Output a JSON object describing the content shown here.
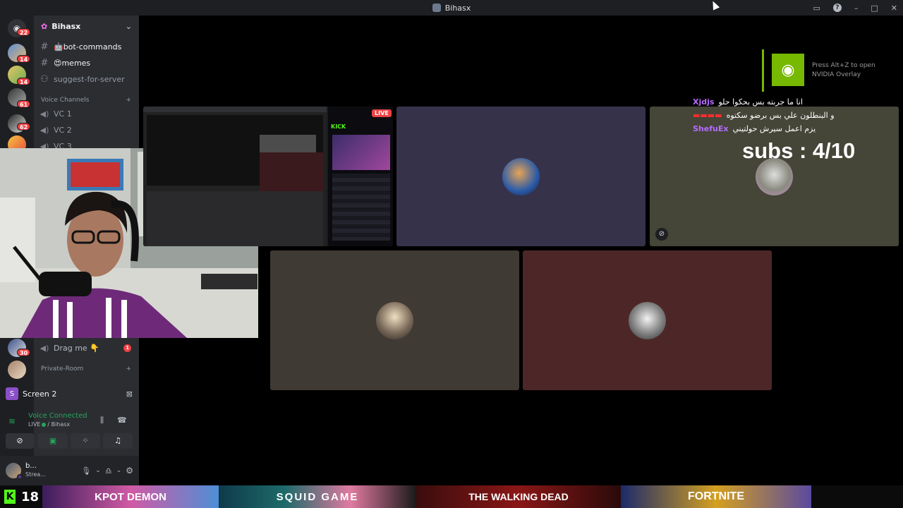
{
  "window": {
    "title": "Bihasx"
  },
  "guilds": {
    "badges": [
      "22",
      "14",
      "14",
      "61",
      "62",
      "30"
    ]
  },
  "server": {
    "name": "Bihasx",
    "channels": [
      {
        "label": "🤖bot-commands"
      },
      {
        "label": "😍memes"
      },
      {
        "label": "suggest-for-server"
      }
    ],
    "voice_category": "Voice Channels",
    "voice_channels": [
      "VC 1",
      "VC 2",
      "VC 3"
    ],
    "drag_channel": "Drag me 👇",
    "drag_badge": "1",
    "private_category": "Private-Room"
  },
  "screen_panel": {
    "label": "Screen 2",
    "letter": "S",
    "status": "Voice Connected",
    "live": "LIVE",
    "sub": " / Bihasx"
  },
  "user": {
    "name": "b...",
    "status": "Strea..."
  },
  "stream": {
    "live_badge": "LIVE",
    "kick_label": "KICK"
  },
  "chat": [
    {
      "user": "Xjdjs",
      "text": "انا ما جربته بس بحكوا حلو",
      "color": "#b66cff"
    },
    {
      "user": "▬▬▬▬",
      "text": "و البنطلون علي بس برضو سكتوه",
      "color": "#ff2d2d"
    },
    {
      "user": "ShefuEx",
      "text": "يزم اعمل سيرش حولتيني",
      "color": "#b66cff"
    }
  ],
  "subs": "subs : 4/10",
  "nvidia": {
    "line1": "Press Alt+Z to open",
    "line2": "NVIDIA Overlay"
  },
  "bottom": {
    "kick_count": "18",
    "thumbs": [
      "KPOT DEMON",
      "SQUID GAME",
      "THE WALKING DEAD",
      "FORTNITE"
    ]
  }
}
